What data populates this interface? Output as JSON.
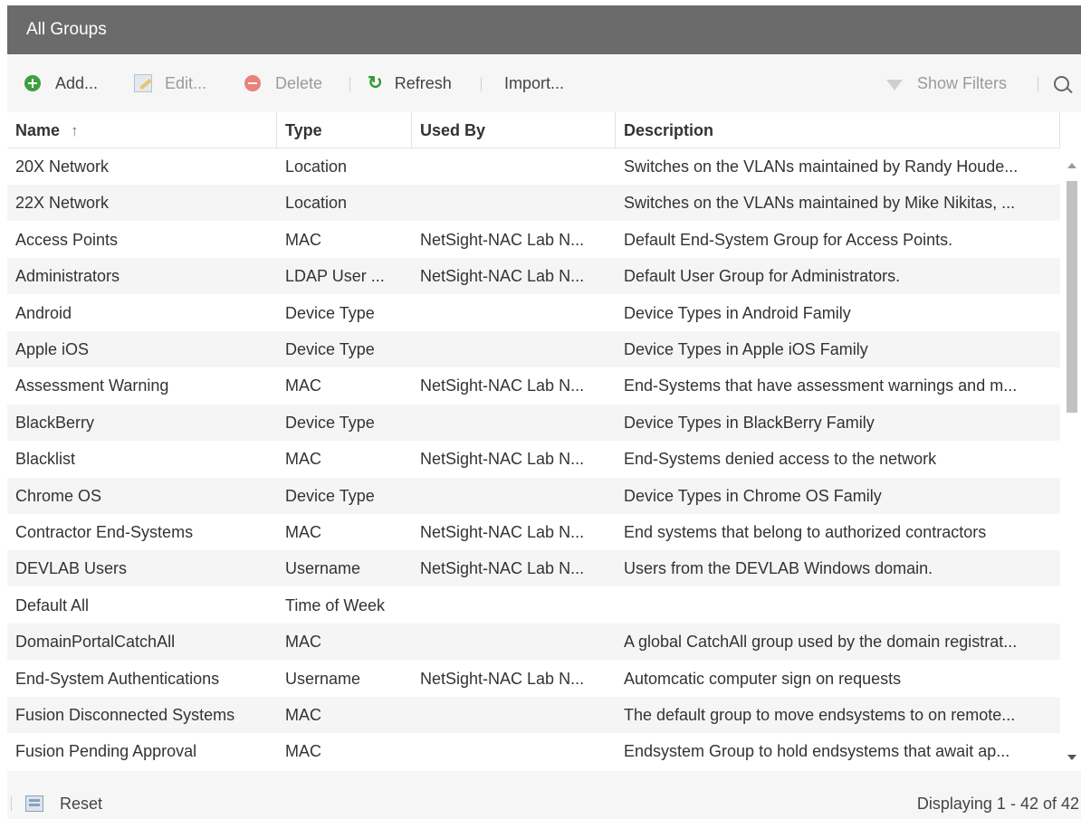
{
  "window": {
    "title": "All Groups"
  },
  "toolbar": {
    "add_label": "Add...",
    "edit_label": "Edit...",
    "delete_label": "Delete",
    "refresh_label": "Refresh",
    "import_label": "Import...",
    "show_filters_label": "Show Filters"
  },
  "grid": {
    "columns": [
      "Name",
      "Type",
      "Used By",
      "Description"
    ],
    "sort_indicator": "↑",
    "rows": [
      [
        "20X Network",
        "Location",
        "",
        "Switches on the VLANs maintained by Randy Houde..."
      ],
      [
        "22X Network",
        "Location",
        "",
        "Switches on the VLANs maintained by Mike Nikitas, ..."
      ],
      [
        "Access Points",
        "MAC",
        "NetSight-NAC Lab N...",
        "Default End-System Group for Access Points."
      ],
      [
        "Administrators",
        "LDAP User ...",
        "NetSight-NAC Lab N...",
        "Default User Group for Administrators."
      ],
      [
        "Android",
        "Device Type",
        "",
        "Device Types in Android Family"
      ],
      [
        "Apple iOS",
        "Device Type",
        "",
        "Device Types in Apple iOS Family"
      ],
      [
        "Assessment Warning",
        "MAC",
        "NetSight-NAC Lab N...",
        "End-Systems that have assessment warnings and m..."
      ],
      [
        "BlackBerry",
        "Device Type",
        "",
        "Device Types in BlackBerry Family"
      ],
      [
        "Blacklist",
        "MAC",
        "NetSight-NAC Lab N...",
        "End-Systems denied access to the network"
      ],
      [
        "Chrome OS",
        "Device Type",
        "",
        "Device Types in Chrome OS Family"
      ],
      [
        "Contractor End-Systems",
        "MAC",
        "NetSight-NAC Lab N...",
        "End systems that belong to authorized contractors"
      ],
      [
        "DEVLAB Users",
        "Username",
        "NetSight-NAC Lab N...",
        "Users from the DEVLAB Windows domain."
      ],
      [
        "Default All",
        "Time of Week",
        "",
        ""
      ],
      [
        "DomainPortalCatchAll",
        "MAC",
        "",
        "A global CatchAll group used by the domain registrat..."
      ],
      [
        "End-System Authentications",
        "Username",
        "NetSight-NAC Lab N...",
        "Automcatic computer sign on requests"
      ],
      [
        "Fusion Disconnected Systems",
        "MAC",
        "",
        "The default group to move endsystems to on remote..."
      ],
      [
        "Fusion Pending Approval",
        "MAC",
        "",
        "Endsystem Group to hold endsystems that await ap..."
      ]
    ]
  },
  "footer": {
    "reset_label": "Reset",
    "paging_text": "Displaying 1 - 42 of 42"
  },
  "colors": {
    "titlebar_bg": "#6b6b6b",
    "add_icon": "#3f9f3f",
    "refresh_icon": "#2f9a2f",
    "delete_icon": "#e9827a"
  },
  "icons": [
    "add-icon",
    "edit-icon",
    "delete-icon",
    "refresh-icon",
    "filter-icon",
    "search-icon",
    "reset-icon",
    "sort-ascending-icon"
  ]
}
